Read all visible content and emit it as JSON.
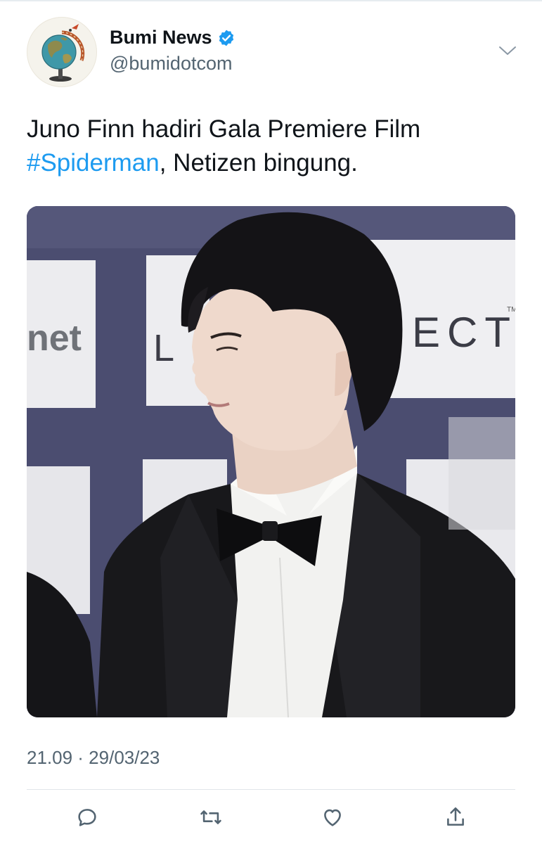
{
  "author": {
    "display_name": "Bumi News",
    "handle": "@bumidotcom",
    "verified": true,
    "avatar": "globe-icon"
  },
  "tweet": {
    "text_before": "Juno Finn hadiri Gala Premiere Film",
    "hashtag": "#Spiderman",
    "text_after": ", Netizen bingung.",
    "timestamp": "21.09 · 29/03/23"
  },
  "media": {
    "backdrop_signs": [
      "net",
      "L",
      "ECT",
      "TM"
    ]
  },
  "actions": [
    {
      "icon": "reply-icon"
    },
    {
      "icon": "retweet-icon"
    },
    {
      "icon": "like-icon"
    },
    {
      "icon": "share-icon"
    }
  ],
  "colors": {
    "accent": "#1d9bf0",
    "text": "#0f1419",
    "secondary": "#536471"
  }
}
